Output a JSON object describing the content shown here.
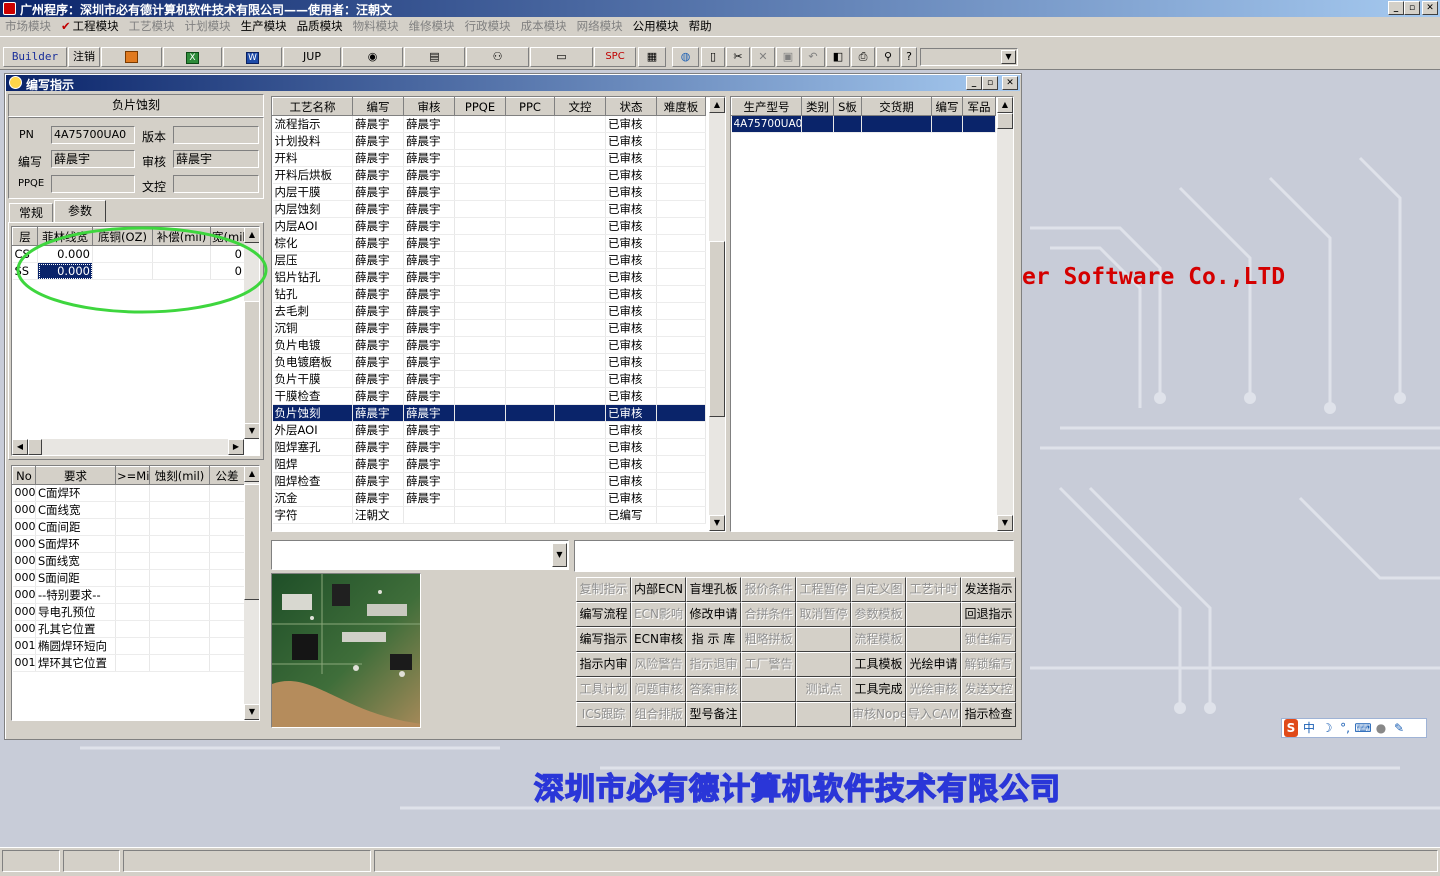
{
  "window": {
    "title": "广州程序：深圳市必有德计算机软件技术有限公司——使用者：汪朝文"
  },
  "menu": [
    {
      "label": "市场模块",
      "enabled": false
    },
    {
      "label": "工程模块",
      "enabled": true,
      "checked": true
    },
    {
      "label": "工艺模块",
      "enabled": false
    },
    {
      "label": "计划模块",
      "enabled": false
    },
    {
      "label": "生产模块",
      "enabled": true
    },
    {
      "label": "品质模块",
      "enabled": true
    },
    {
      "label": "物料模块",
      "enabled": false
    },
    {
      "label": "维修模块",
      "enabled": false
    },
    {
      "label": "行政模块",
      "enabled": false
    },
    {
      "label": "成本模块",
      "enabled": false
    },
    {
      "label": "网络模块",
      "enabled": false
    },
    {
      "label": "公用模块",
      "enabled": true
    },
    {
      "label": "帮助",
      "enabled": true
    }
  ],
  "toolbar": {
    "builder": "Builder",
    "logout": "注销",
    "jup": "JUP",
    "spc": "SPC"
  },
  "background": {
    "software_text": "er Software Co.,LTD",
    "company_text": "深圳市必有德计算机软件技术有限公司"
  },
  "child": {
    "title": "编写指示",
    "process_name": "负片蚀刻",
    "fields": {
      "pn_label": "PN",
      "pn_value": "4A75700UA0",
      "version_label": "版本",
      "version_value": "",
      "writer_label": "编写",
      "writer_value": "薛晨宇",
      "auditor_label": "审核",
      "auditor_value": "薛晨宇",
      "ppqe_label": "PPQE",
      "ppqe_value": "",
      "doc_label": "文控",
      "doc_value": ""
    },
    "tabs": [
      "常规",
      "参数"
    ],
    "param_grid": {
      "headers": [
        "层",
        "菲林线宽",
        "底铜(OZ)",
        "补偿(mil)",
        "宽(mil"
      ],
      "rows": [
        {
          "layer": "CS",
          "width": "0.000",
          "copper": "",
          "comp": "",
          "w": "0"
        },
        {
          "layer": "SS",
          "width": "0.000",
          "copper": "",
          "comp": "",
          "w": "0"
        }
      ]
    },
    "req_grid": {
      "headers": [
        "No",
        "要求",
        ">=Mil",
        "蚀刻(mil)",
        "公差"
      ],
      "rows": [
        {
          "no": "000",
          "req": "C面焊环"
        },
        {
          "no": "000",
          "req": "C面线宽"
        },
        {
          "no": "000",
          "req": "C面间距"
        },
        {
          "no": "000",
          "req": "S面焊环"
        },
        {
          "no": "000",
          "req": "S面线宽"
        },
        {
          "no": "000",
          "req": "S面间距"
        },
        {
          "no": "000",
          "req": "--特别要求--"
        },
        {
          "no": "000",
          "req": "导电孔预位"
        },
        {
          "no": "000",
          "req": "孔其它位置"
        },
        {
          "no": "001",
          "req": "椭圆焊环短向"
        },
        {
          "no": "001",
          "req": "焊环其它位置"
        }
      ]
    },
    "process_grid": {
      "headers": [
        "工艺名称",
        "编写",
        "审核",
        "PPQE",
        "PPC",
        "文控",
        "状态",
        "难度板"
      ],
      "selected_index": 17,
      "rows": [
        {
          "name": "流程指示",
          "writer": "薛晨宇",
          "auditor": "薛晨宇",
          "status": "已审核"
        },
        {
          "name": "计划投料",
          "writer": "薛晨宇",
          "auditor": "薛晨宇",
          "status": "已审核"
        },
        {
          "name": "开料",
          "writer": "薛晨宇",
          "auditor": "薛晨宇",
          "status": "已审核"
        },
        {
          "name": "开料后烘板",
          "writer": "薛晨宇",
          "auditor": "薛晨宇",
          "status": "已审核"
        },
        {
          "name": "内层干膜",
          "writer": "薛晨宇",
          "auditor": "薛晨宇",
          "status": "已审核"
        },
        {
          "name": "内层蚀刻",
          "writer": "薛晨宇",
          "auditor": "薛晨宇",
          "status": "已审核"
        },
        {
          "name": "内层AOI",
          "writer": "薛晨宇",
          "auditor": "薛晨宇",
          "status": "已审核"
        },
        {
          "name": "棕化",
          "writer": "薛晨宇",
          "auditor": "薛晨宇",
          "status": "已审核"
        },
        {
          "name": "层压",
          "writer": "薛晨宇",
          "auditor": "薛晨宇",
          "status": "已审核"
        },
        {
          "name": "铝片钻孔",
          "writer": "薛晨宇",
          "auditor": "薛晨宇",
          "status": "已审核"
        },
        {
          "name": "钻孔",
          "writer": "薛晨宇",
          "auditor": "薛晨宇",
          "status": "已审核"
        },
        {
          "name": "去毛刺",
          "writer": "薛晨宇",
          "auditor": "薛晨宇",
          "status": "已审核"
        },
        {
          "name": "沉铜",
          "writer": "薛晨宇",
          "auditor": "薛晨宇",
          "status": "已审核"
        },
        {
          "name": "负片电镀",
          "writer": "薛晨宇",
          "auditor": "薛晨宇",
          "status": "已审核"
        },
        {
          "name": "负电镀磨板",
          "writer": "薛晨宇",
          "auditor": "薛晨宇",
          "status": "已审核"
        },
        {
          "name": "负片干膜",
          "writer": "薛晨宇",
          "auditor": "薛晨宇",
          "status": "已审核"
        },
        {
          "name": "干膜检查",
          "writer": "薛晨宇",
          "auditor": "薛晨宇",
          "status": "已审核"
        },
        {
          "name": "负片蚀刻",
          "writer": "薛晨宇",
          "auditor": "薛晨宇",
          "status": "已审核"
        },
        {
          "name": "外层AOI",
          "writer": "薛晨宇",
          "auditor": "薛晨宇",
          "status": "已审核"
        },
        {
          "name": "阻焊塞孔",
          "writer": "薛晨宇",
          "auditor": "薛晨宇",
          "status": "已审核"
        },
        {
          "name": "阻焊",
          "writer": "薛晨宇",
          "auditor": "薛晨宇",
          "status": "已审核"
        },
        {
          "name": "阻焊检查",
          "writer": "薛晨宇",
          "auditor": "薛晨宇",
          "status": "已审核"
        },
        {
          "name": "沉金",
          "writer": "薛晨宇",
          "auditor": "薛晨宇",
          "status": "已审核"
        },
        {
          "name": "字符",
          "writer": "汪朝文",
          "auditor": "",
          "status": "已编写"
        }
      ]
    },
    "model_grid": {
      "headers": [
        "生产型号",
        "类别",
        "S板",
        "交货期",
        "编写",
        "军品"
      ],
      "rows": [
        {
          "model": "4A75700UA0"
        }
      ]
    },
    "actions": [
      [
        "复制指示",
        "内部ECN",
        "盲埋孔板",
        "报价条件",
        "工程暂停",
        "自定义图",
        "工艺计时",
        "发送指示"
      ],
      [
        "编写流程",
        "ECN影响",
        "修改申请",
        "合拼条件",
        "取消暂停",
        "参数模板",
        "",
        "回退指示"
      ],
      [
        "编写指示",
        "ECN审核",
        "指 示 库",
        "粗略拼板",
        "",
        "流程模板",
        "",
        "锁住编写"
      ],
      [
        "指示内审",
        "风险警告",
        "指示退审",
        "工厂警告",
        "",
        "工具模板",
        "光绘申请",
        "解锁编写"
      ],
      [
        "工具计划",
        "问题审核",
        "答案审核",
        "",
        "测试点",
        "工具完成",
        "光绘审核",
        "发送文控"
      ],
      [
        "ICS跟踪",
        "组合排版",
        "型号备注",
        "",
        "",
        "审核Nope",
        "导入CAM",
        "指示检查"
      ]
    ],
    "actions_enabled": [
      [
        false,
        true,
        true,
        false,
        false,
        false,
        false,
        true
      ],
      [
        true,
        false,
        true,
        false,
        false,
        false,
        false,
        true
      ],
      [
        true,
        true,
        true,
        false,
        false,
        false,
        false,
        false
      ],
      [
        true,
        false,
        false,
        false,
        false,
        true,
        true,
        false
      ],
      [
        false,
        false,
        false,
        false,
        false,
        true,
        false,
        false
      ],
      [
        false,
        false,
        true,
        false,
        false,
        false,
        false,
        true
      ]
    ]
  },
  "ime": {
    "label": "中"
  },
  "colors": {
    "accent": "#0a246a",
    "dialog_bg": "#d4d0c8",
    "annotation": "#3ed63e",
    "brand_text": "#d40000",
    "company_text": "#2a36d8"
  }
}
